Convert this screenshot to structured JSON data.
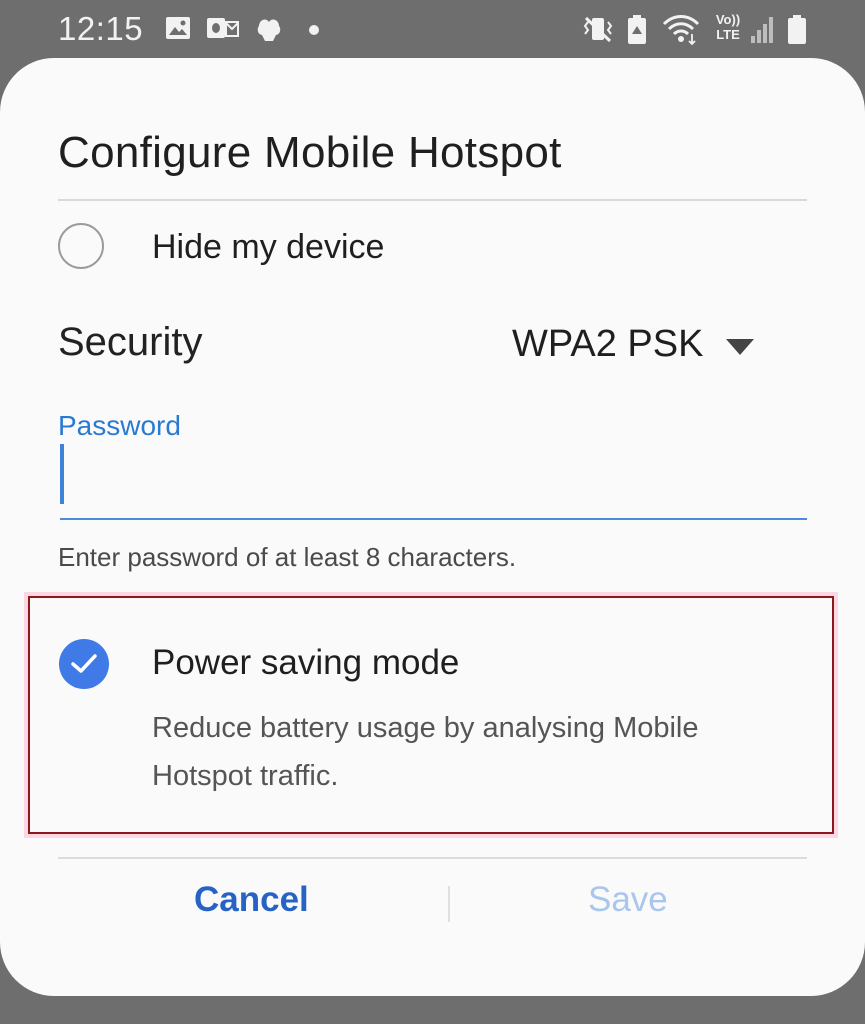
{
  "status_bar": {
    "time": "12:15",
    "icons": [
      "image-icon",
      "outlook-icon",
      "app-icon",
      "dot-icon",
      "vibrate-icon",
      "battery-saver-icon",
      "wifi-icon",
      "volte-icon",
      "signal-icon",
      "battery-icon"
    ],
    "volte_text": "Vo))",
    "lte_text": "LTE"
  },
  "dialog": {
    "title": "Configure Mobile Hotspot",
    "hide_device": {
      "label": "Hide my device",
      "checked": false
    },
    "security": {
      "label": "Security",
      "value": "WPA2 PSK"
    },
    "password": {
      "label": "Password",
      "value": "",
      "helper": "Enter password of at least 8 characters."
    },
    "power_saving": {
      "title": "Power saving mode",
      "description": "Reduce battery usage by analysing Mobile Hotspot traffic.",
      "checked": true
    },
    "buttons": {
      "cancel": "Cancel",
      "save": "Save"
    }
  },
  "colors": {
    "accent": "#3f7ae6",
    "cancel": "#2663c4",
    "save_disabled": "#a9c6ee",
    "highlight_border": "#8a1a1a"
  }
}
